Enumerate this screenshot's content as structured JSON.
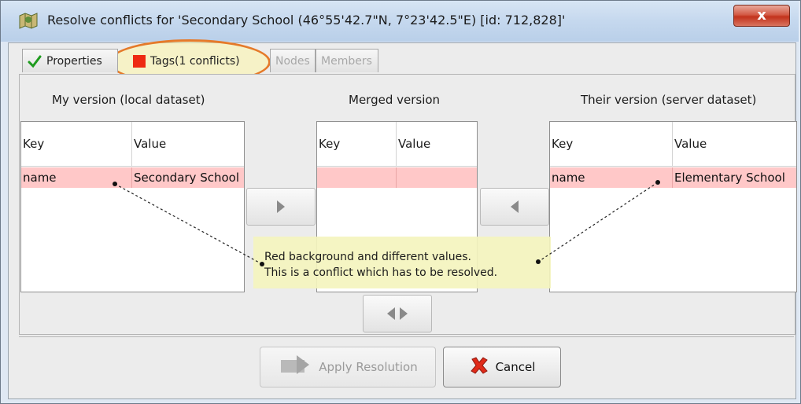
{
  "window": {
    "title": "Resolve conflicts for 'Secondary School (46°55'42.7\"N, 7°23'42.5\"E) [id: 712,828]'",
    "close_label": "x"
  },
  "tabs": [
    {
      "label": "Properties",
      "state": "normal"
    },
    {
      "label": "Tags(1 conflicts)",
      "state": "active"
    },
    {
      "label": "Nodes",
      "state": "disabled"
    },
    {
      "label": "Members",
      "state": "disabled"
    }
  ],
  "columns": {
    "mine": {
      "title": "My version (local dataset)",
      "headers": {
        "key": "Key",
        "value": "Value"
      },
      "row": {
        "key": "name",
        "value": "Secondary School"
      }
    },
    "merged": {
      "title": "Merged version",
      "headers": {
        "key": "Key",
        "value": "Value"
      },
      "row": {
        "key": "",
        "value": ""
      }
    },
    "theirs": {
      "title": "Their version (server dataset)",
      "headers": {
        "key": "Key",
        "value": "Value"
      },
      "row": {
        "key": "name",
        "value": "Elementary School"
      }
    }
  },
  "tooltip": {
    "line1": "Red background and different values.",
    "line2": "This is a conflict which has to be resolved."
  },
  "footer": {
    "apply_label": "Apply Resolution",
    "cancel_label": "Cancel"
  },
  "colors": {
    "conflict_row": "#ffc8c8",
    "tooltip_bg": "#f4f4be",
    "highlight_ring": "#e57a2a",
    "tag_marker": "#ee2a12"
  },
  "icons": [
    "app-map-icon",
    "checkmark-icon",
    "conflict-marker-icon",
    "arrow-right-icon",
    "arrow-left-icon",
    "arrow-both-icon",
    "apply-icon",
    "cancel-x-icon"
  ]
}
